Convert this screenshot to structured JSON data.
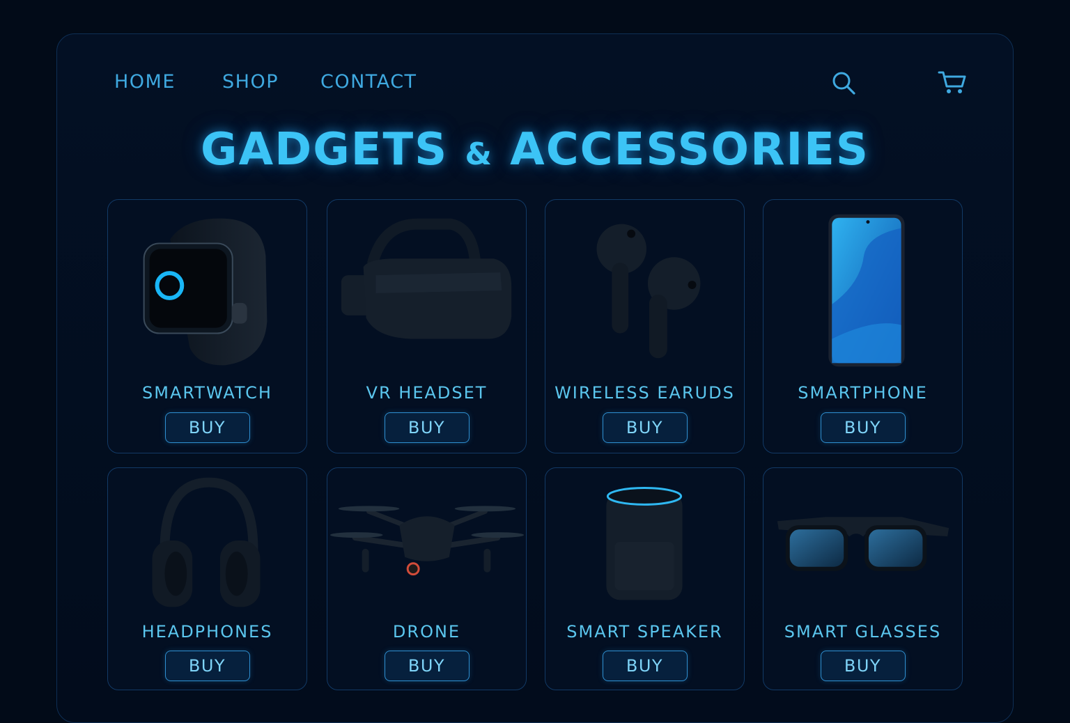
{
  "nav": {
    "links": [
      "HOME",
      "SHOP",
      "CONTACT"
    ],
    "search_icon": "search-icon",
    "cart_icon": "cart-icon"
  },
  "title": {
    "left": "GADGETS",
    "amp": "&",
    "right": "ACCESSORIES"
  },
  "products": [
    {
      "name": "SMARTWATCH",
      "buy_label": "BUY",
      "icon": "smartwatch-image"
    },
    {
      "name": "VR HEADSET",
      "buy_label": "BUY",
      "icon": "vr-headset-image"
    },
    {
      "name": "WIRELESS EARUDS",
      "buy_label": "BUY",
      "icon": "earbuds-image"
    },
    {
      "name": "SMARTPHONE",
      "buy_label": "BUY",
      "icon": "smartphone-image"
    },
    {
      "name": "HEADPHONES",
      "buy_label": "BUY",
      "icon": "headphones-image"
    },
    {
      "name": "DRONE",
      "buy_label": "BUY",
      "icon": "drone-image"
    },
    {
      "name": "SMART SPEAKER",
      "buy_label": "BUY",
      "icon": "smart-speaker-image"
    },
    {
      "name": "SMART GLASSES",
      "buy_label": "BUY",
      "icon": "smart-glasses-image"
    }
  ],
  "colors": {
    "background": "#020b18",
    "accent": "#3cc4f6",
    "border": "#123a66"
  }
}
